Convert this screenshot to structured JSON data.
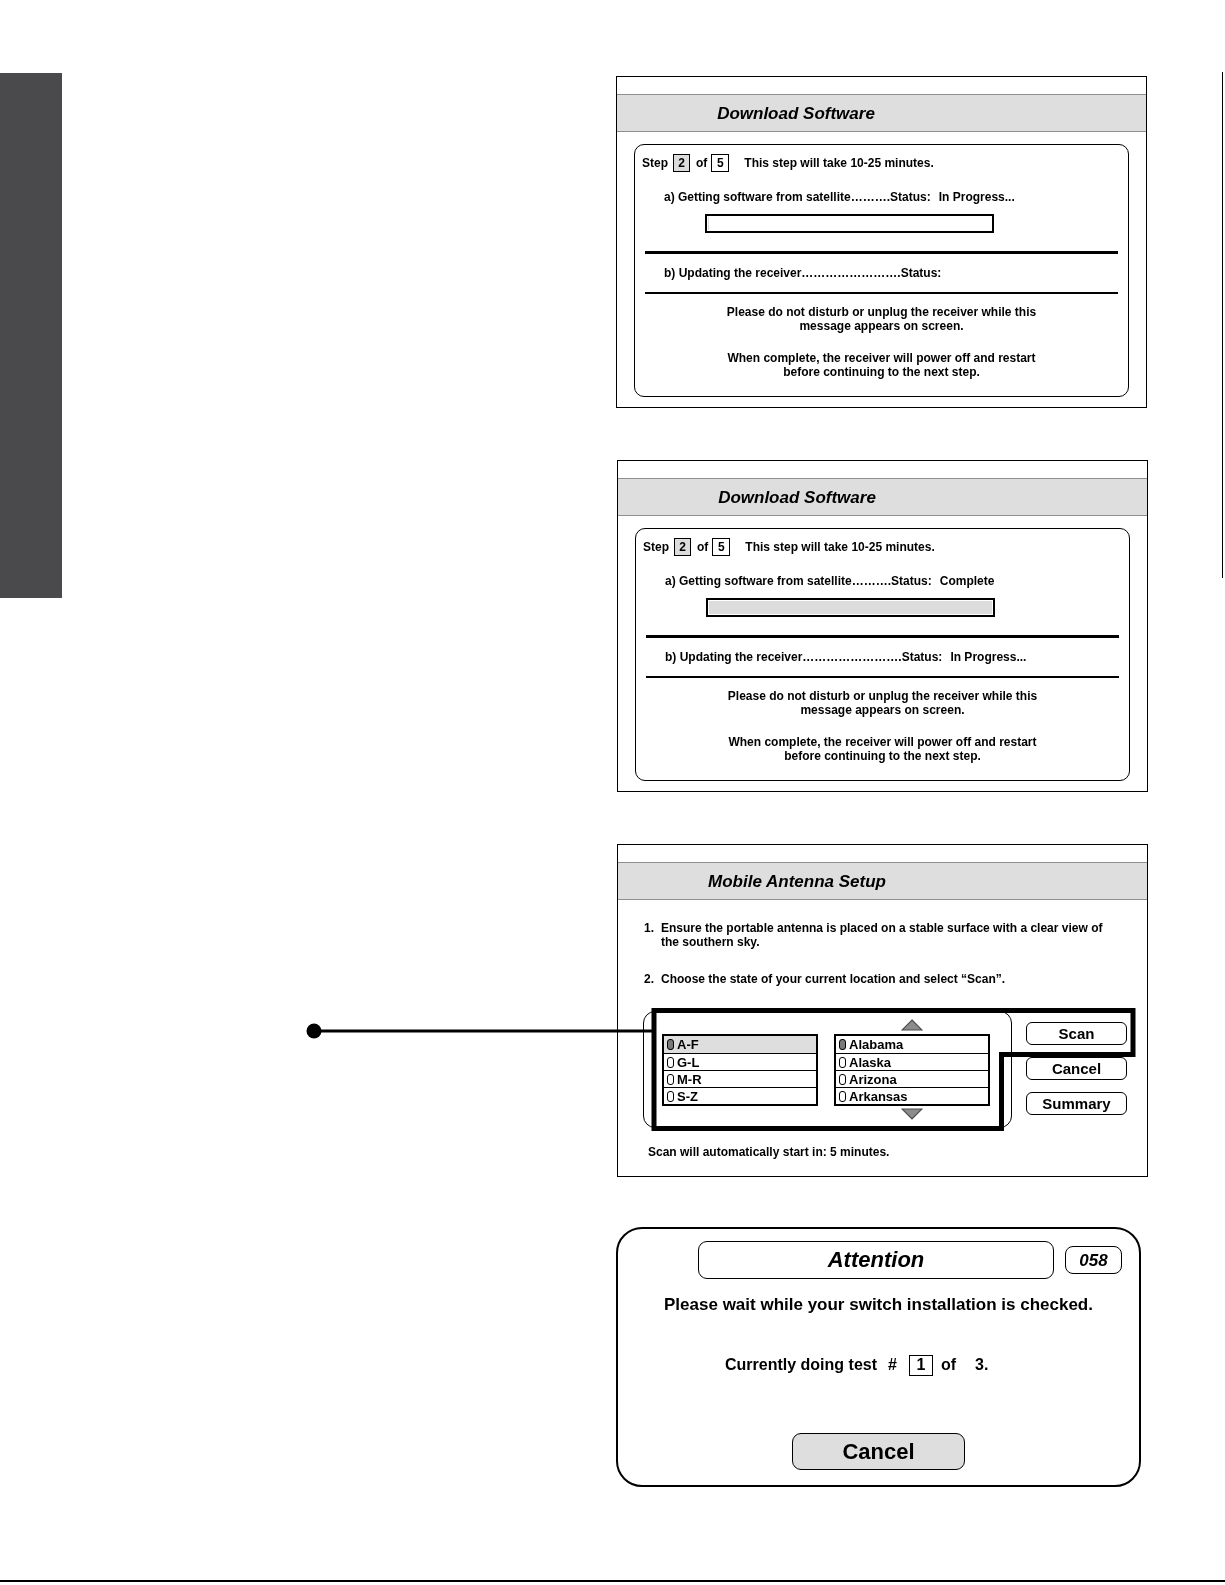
{
  "screens": [
    {
      "kind": "download",
      "title": "Download Software",
      "step": {
        "label": "Step",
        "current": "2",
        "of": "of",
        "total": "5",
        "note": "This step will take 10-25 minutes."
      },
      "tasks": [
        {
          "kind": "progress",
          "label": "a) Getting software from satellite……….Status:",
          "status": "In Progress...",
          "level": 0
        },
        {
          "kind": "plain",
          "label": "b) Updating the receiver…………………….Status:"
        }
      ],
      "messages": [
        "Please do not disturb or unplug the receiver while this message appears on screen.",
        "When complete, the receiver will power off and restart before continuing to the next step."
      ]
    },
    {
      "kind": "download",
      "title": "Download Software",
      "step": {
        "label": "Step",
        "current": "2",
        "of": "of",
        "total": "5",
        "note": "This step will take 10-25 minutes."
      },
      "tasks": [
        {
          "kind": "progress",
          "label": "a) Getting software from satellite……….Status:",
          "status": "Complete",
          "level": 1
        },
        {
          "kind": "plain",
          "label": "b) Updating the receiver…………………….Status:",
          "status": "In Progress..."
        }
      ],
      "messages": [
        "Please do not disturb or unplug the receiver while this message appears on screen.",
        "When complete, the receiver will power off and restart before continuing to the next step."
      ]
    },
    {
      "kind": "antenna",
      "title": "Mobile Antenna Setup",
      "instructions": [
        {
          "number": "1.",
          "text": "Ensure the portable antenna is placed on a stable surface with a clear view of the southern sky."
        },
        {
          "number": "2.",
          "text": "Choose the state of your current location and select “Scan”."
        }
      ],
      "groups": [
        {
          "label": "A-F",
          "selected": true,
          "focused": true
        },
        {
          "label": "G-L",
          "selected": false,
          "focused": false
        },
        {
          "label": "M-R",
          "selected": false,
          "focused": false
        },
        {
          "label": "S-Z",
          "selected": false,
          "focused": false
        }
      ],
      "states": [
        {
          "label": "Alabama",
          "selected": true,
          "focused": false
        },
        {
          "label": "Alaska",
          "selected": false,
          "focused": false
        },
        {
          "label": "Arizona",
          "selected": false,
          "focused": false
        },
        {
          "label": "Arkansas",
          "selected": false,
          "focused": false
        }
      ],
      "buttons": [
        "Scan",
        "Cancel",
        "Summary"
      ],
      "footer": "Scan will automatically start in: 5 minutes."
    },
    {
      "kind": "attention",
      "title": "Attention",
      "code": "058",
      "message": "Please wait while your switch installation is checked.",
      "test": {
        "label": "Currently doing test",
        "hash": "#",
        "current": "1",
        "of": "of",
        "total": "3."
      },
      "button": "Cancel"
    }
  ]
}
